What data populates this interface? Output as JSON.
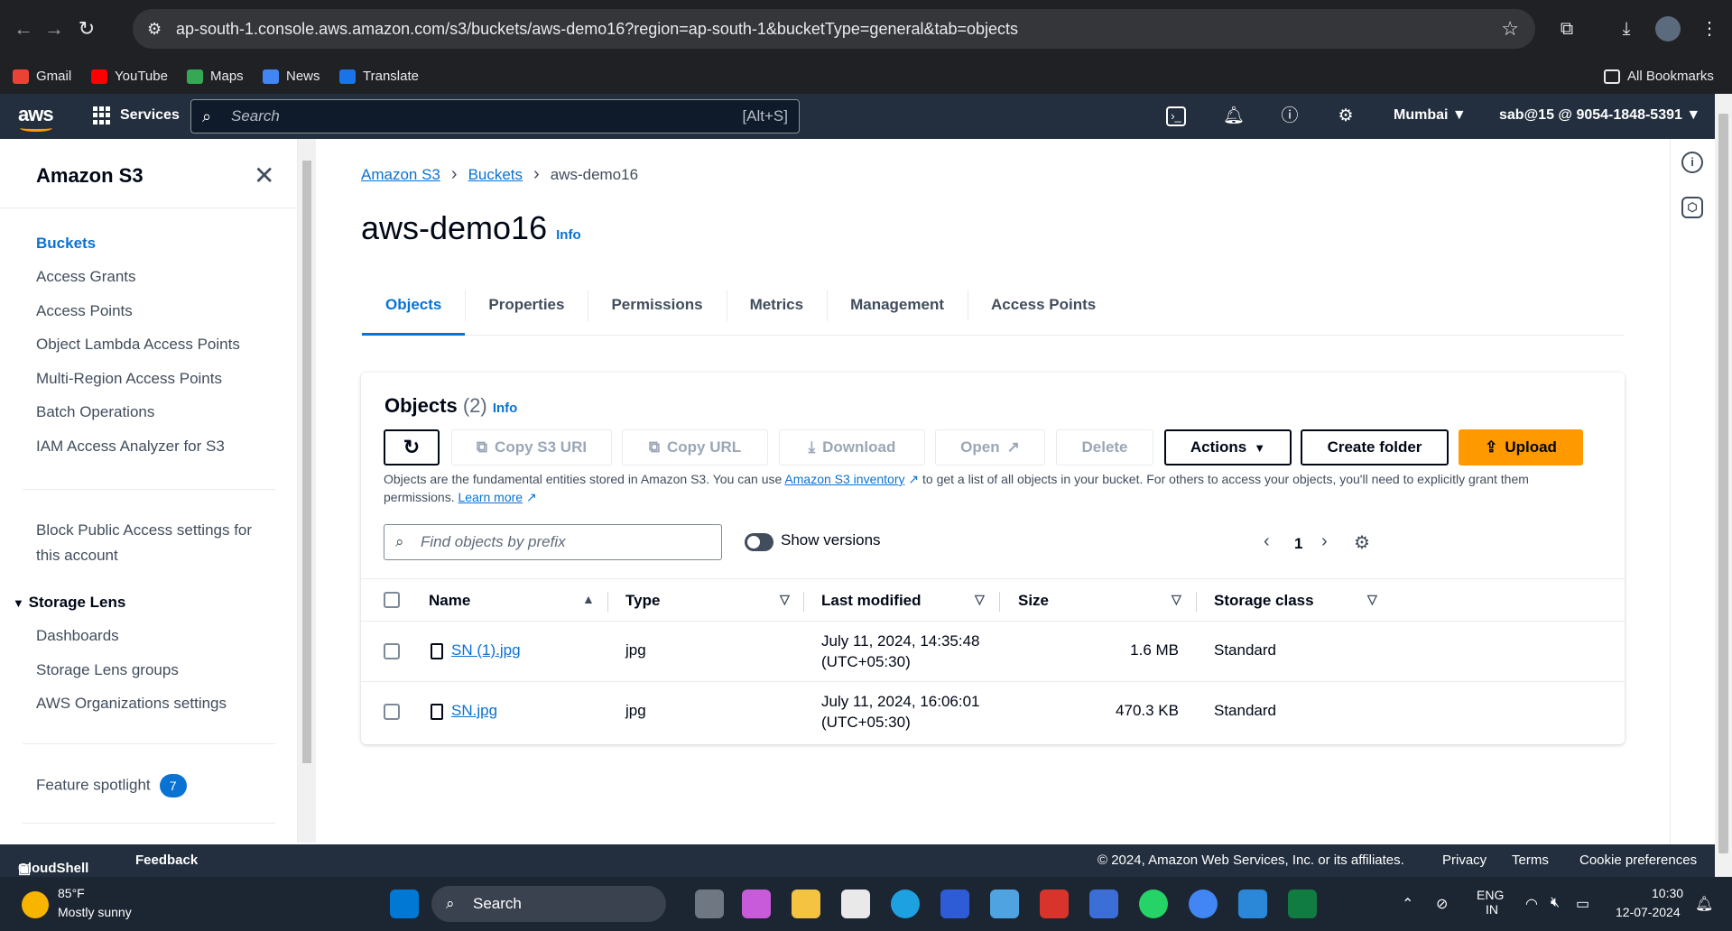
{
  "browser": {
    "url": "ap-south-1.console.aws.amazon.com/s3/buckets/aws-demo16?region=ap-south-1&bucketType=general&tab=objects",
    "bookmarks": [
      "Gmail",
      "YouTube",
      "Maps",
      "News",
      "Translate"
    ],
    "all_bookmarks": "All Bookmarks"
  },
  "aws_header": {
    "logo": "aws",
    "services": "Services",
    "search_placeholder": "Search",
    "search_shortcut": "[Alt+S]",
    "region": "Mumbai ▼",
    "account": "sab@15 @ 9054-1848-5391 ▼"
  },
  "sidebar": {
    "title": "Amazon S3",
    "items": [
      "Buckets",
      "Access Grants",
      "Access Points",
      "Object Lambda Access Points",
      "Multi-Region Access Points",
      "Batch Operations",
      "IAM Access Analyzer for S3"
    ],
    "block_public_1": "Block Public Access settings for",
    "block_public_2": "this account",
    "storage_lens": "Storage Lens",
    "lens_items": [
      "Dashboards",
      "Storage Lens groups",
      "AWS Organizations settings"
    ],
    "feature_spotlight": "Feature spotlight",
    "feature_count": "7"
  },
  "breadcrumb": [
    "Amazon S3",
    "Buckets",
    "aws-demo16"
  ],
  "page_title": "aws-demo16",
  "info": "Info",
  "tabs": [
    "Objects",
    "Properties",
    "Permissions",
    "Metrics",
    "Management",
    "Access Points"
  ],
  "objects_panel": {
    "title": "Objects",
    "count": "(2)",
    "buttons": {
      "copy_s3_uri": "Copy S3 URI",
      "copy_url": "Copy URL",
      "download": "Download",
      "open": "Open",
      "delete": "Delete",
      "actions": "Actions",
      "create_folder": "Create folder",
      "upload": "Upload"
    },
    "desc_1": "Objects are the fundamental entities stored in Amazon S3. You can use ",
    "desc_link": "Amazon S3 inventory",
    "desc_2": " to get a list of all objects in your bucket. For others to access your objects, you'll need to explicitly grant them permissions. ",
    "learn_more": "Learn more",
    "filter_placeholder": "Find objects by prefix",
    "show_versions": "Show versions",
    "page": "1",
    "columns": [
      "Name",
      "Type",
      "Last modified",
      "Size",
      "Storage class"
    ],
    "rows": [
      {
        "name": "SN (1).jpg",
        "type": "jpg",
        "modified_1": "July 11, 2024, 14:35:48",
        "modified_2": "(UTC+05:30)",
        "size": "1.6 MB",
        "class": "Standard"
      },
      {
        "name": "SN.jpg",
        "type": "jpg",
        "modified_1": "July 11, 2024, 16:06:01",
        "modified_2": "(UTC+05:30)",
        "size": "470.3 KB",
        "class": "Standard"
      }
    ]
  },
  "footer": {
    "cloudshell": "CloudShell",
    "feedback": "Feedback",
    "copyright": "© 2024, Amazon Web Services, Inc. or its affiliates.",
    "privacy": "Privacy",
    "terms": "Terms",
    "cookies": "Cookie preferences"
  },
  "taskbar": {
    "temp": "85°F",
    "weather": "Mostly sunny",
    "search": "Search",
    "lang_1": "ENG",
    "lang_2": "IN",
    "time": "10:30",
    "date": "12-07-2024"
  },
  "colors": {
    "aws_nav": "#232f3e",
    "link": "#0972d3",
    "upload": "#ff9900"
  }
}
